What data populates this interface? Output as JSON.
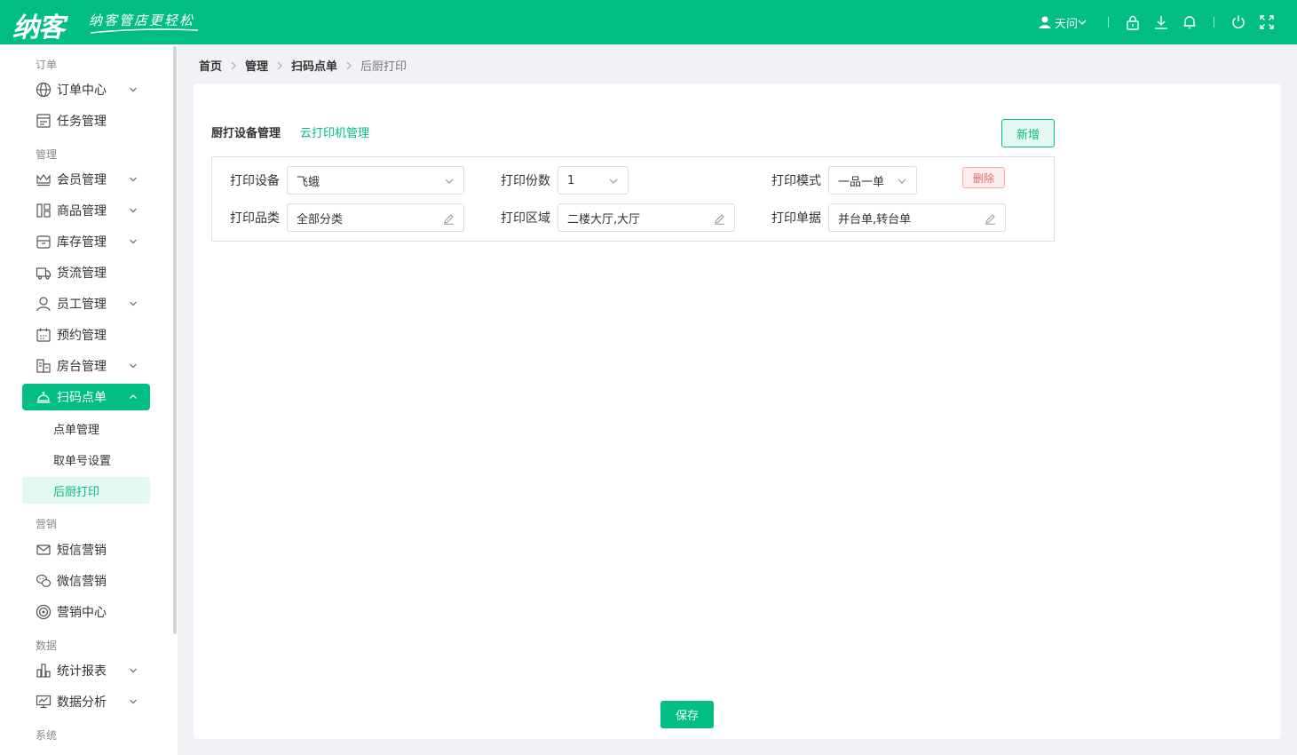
{
  "header": {
    "logo": "纳客",
    "tagline": "纳客管店更轻松",
    "user_name": "天问"
  },
  "sidebar": {
    "groups": {
      "order": "订单",
      "manage": "管理",
      "marketing": "营销",
      "data": "数据",
      "system": "系统"
    },
    "items": {
      "order_center": "订单中心",
      "task_manage": "任务管理",
      "member_manage": "会员管理",
      "product_manage": "商品管理",
      "stock_manage": "库存管理",
      "logistics_manage": "货流管理",
      "staff_manage": "员工管理",
      "booking_manage": "预约管理",
      "room_manage": "房台管理",
      "scan_order": "扫码点单",
      "sms_marketing": "短信营销",
      "wechat_marketing": "微信营销",
      "marketing_center": "营销中心",
      "stats_report": "统计报表",
      "data_analysis": "数据分析"
    },
    "sub_items": {
      "order_manage": "点单管理",
      "pickup_number": "取单号设置",
      "kitchen_print": "后厨打印"
    }
  },
  "breadcrumb": [
    "首页",
    "管理",
    "扫码点单",
    "后厨打印"
  ],
  "main": {
    "tab_active": "厨打设备管理",
    "tab_link": "云打印机管理",
    "add_label": "新增",
    "delete_label": "删除",
    "save_label": "保存",
    "fields": {
      "device_label": "打印设备",
      "device_value": "飞蛾",
      "copies_label": "打印份数",
      "copies_value": "1",
      "mode_label": "打印模式",
      "mode_value": "一品一单",
      "category_label": "打印品类",
      "category_value": "全部分类",
      "area_label": "打印区域",
      "area_value": "二楼大厅,大厅",
      "receipt_label": "打印单据",
      "receipt_value": "并台单,转台单"
    }
  },
  "colors": {
    "brand": "#03be84",
    "danger": "#e46a6a"
  }
}
